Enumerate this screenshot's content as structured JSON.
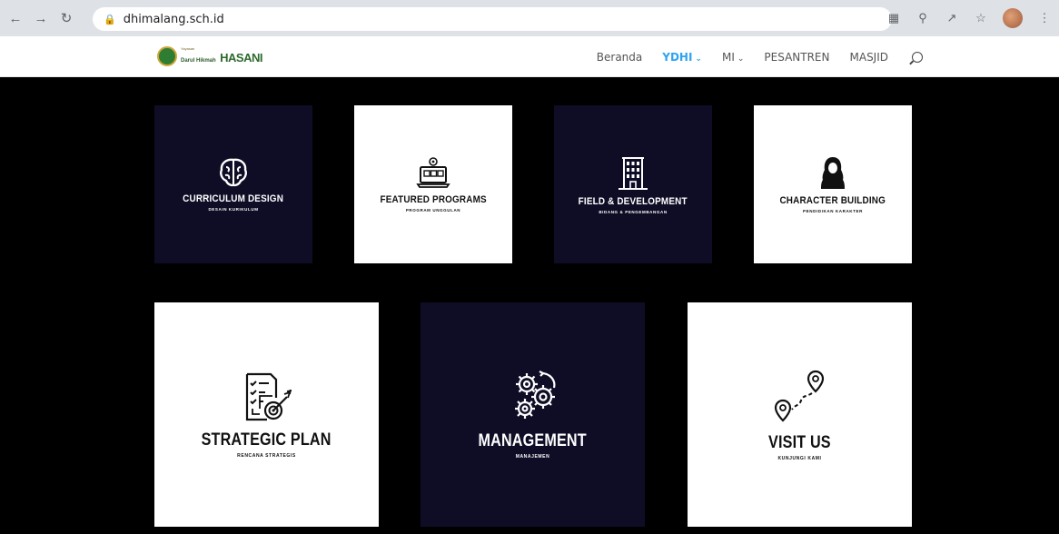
{
  "browser": {
    "url": "dhimalang.sch.id"
  },
  "header": {
    "logo": {
      "line1": "Yayasan",
      "line2": "Darul Hikmah",
      "line3": "HASANI"
    },
    "menu": [
      {
        "label": "Beranda",
        "active": false,
        "dropdown": false
      },
      {
        "label": "YDHI",
        "active": true,
        "dropdown": true
      },
      {
        "label": "MI",
        "active": false,
        "dropdown": true
      },
      {
        "label": "PESANTREN",
        "active": false,
        "dropdown": false
      },
      {
        "label": "MASJID",
        "active": false,
        "dropdown": false
      }
    ]
  },
  "tiles": [
    {
      "title": "CURRICULUM DESIGN",
      "subtitle": "DESAIN KURIKULUM",
      "theme": "dark",
      "icon": "brain-icon"
    },
    {
      "title": "FEATURED PROGRAMS",
      "subtitle": "PROGRAM UNGGULAN",
      "theme": "light",
      "icon": "laptop-gear-icon"
    },
    {
      "title": "FIELD & DEVELOPMENT",
      "subtitle": "BIDANG & PENGEMBANGAN",
      "theme": "dark",
      "icon": "building-icon"
    },
    {
      "title": "CHARACTER BUILDING",
      "subtitle": "PENDIDIKAN KARAKTER",
      "theme": "light",
      "icon": "hijab-woman-icon"
    },
    {
      "title": "STRATEGIC PLAN",
      "subtitle": "RENCANA STRATEGIS",
      "theme": "light",
      "icon": "checklist-target-icon"
    },
    {
      "title": "MANAGEMENT",
      "subtitle": "MANAJEMEN",
      "theme": "dark",
      "icon": "gears-icon"
    },
    {
      "title": "VISIT US",
      "subtitle": "KUNJUNGI KAMI",
      "theme": "light",
      "icon": "map-route-icon"
    }
  ],
  "colors": {
    "page_bg": "#000000",
    "tile_dark": "#0f0d26",
    "tile_light": "#ffffff",
    "menu_active": "#2ea3f2"
  }
}
